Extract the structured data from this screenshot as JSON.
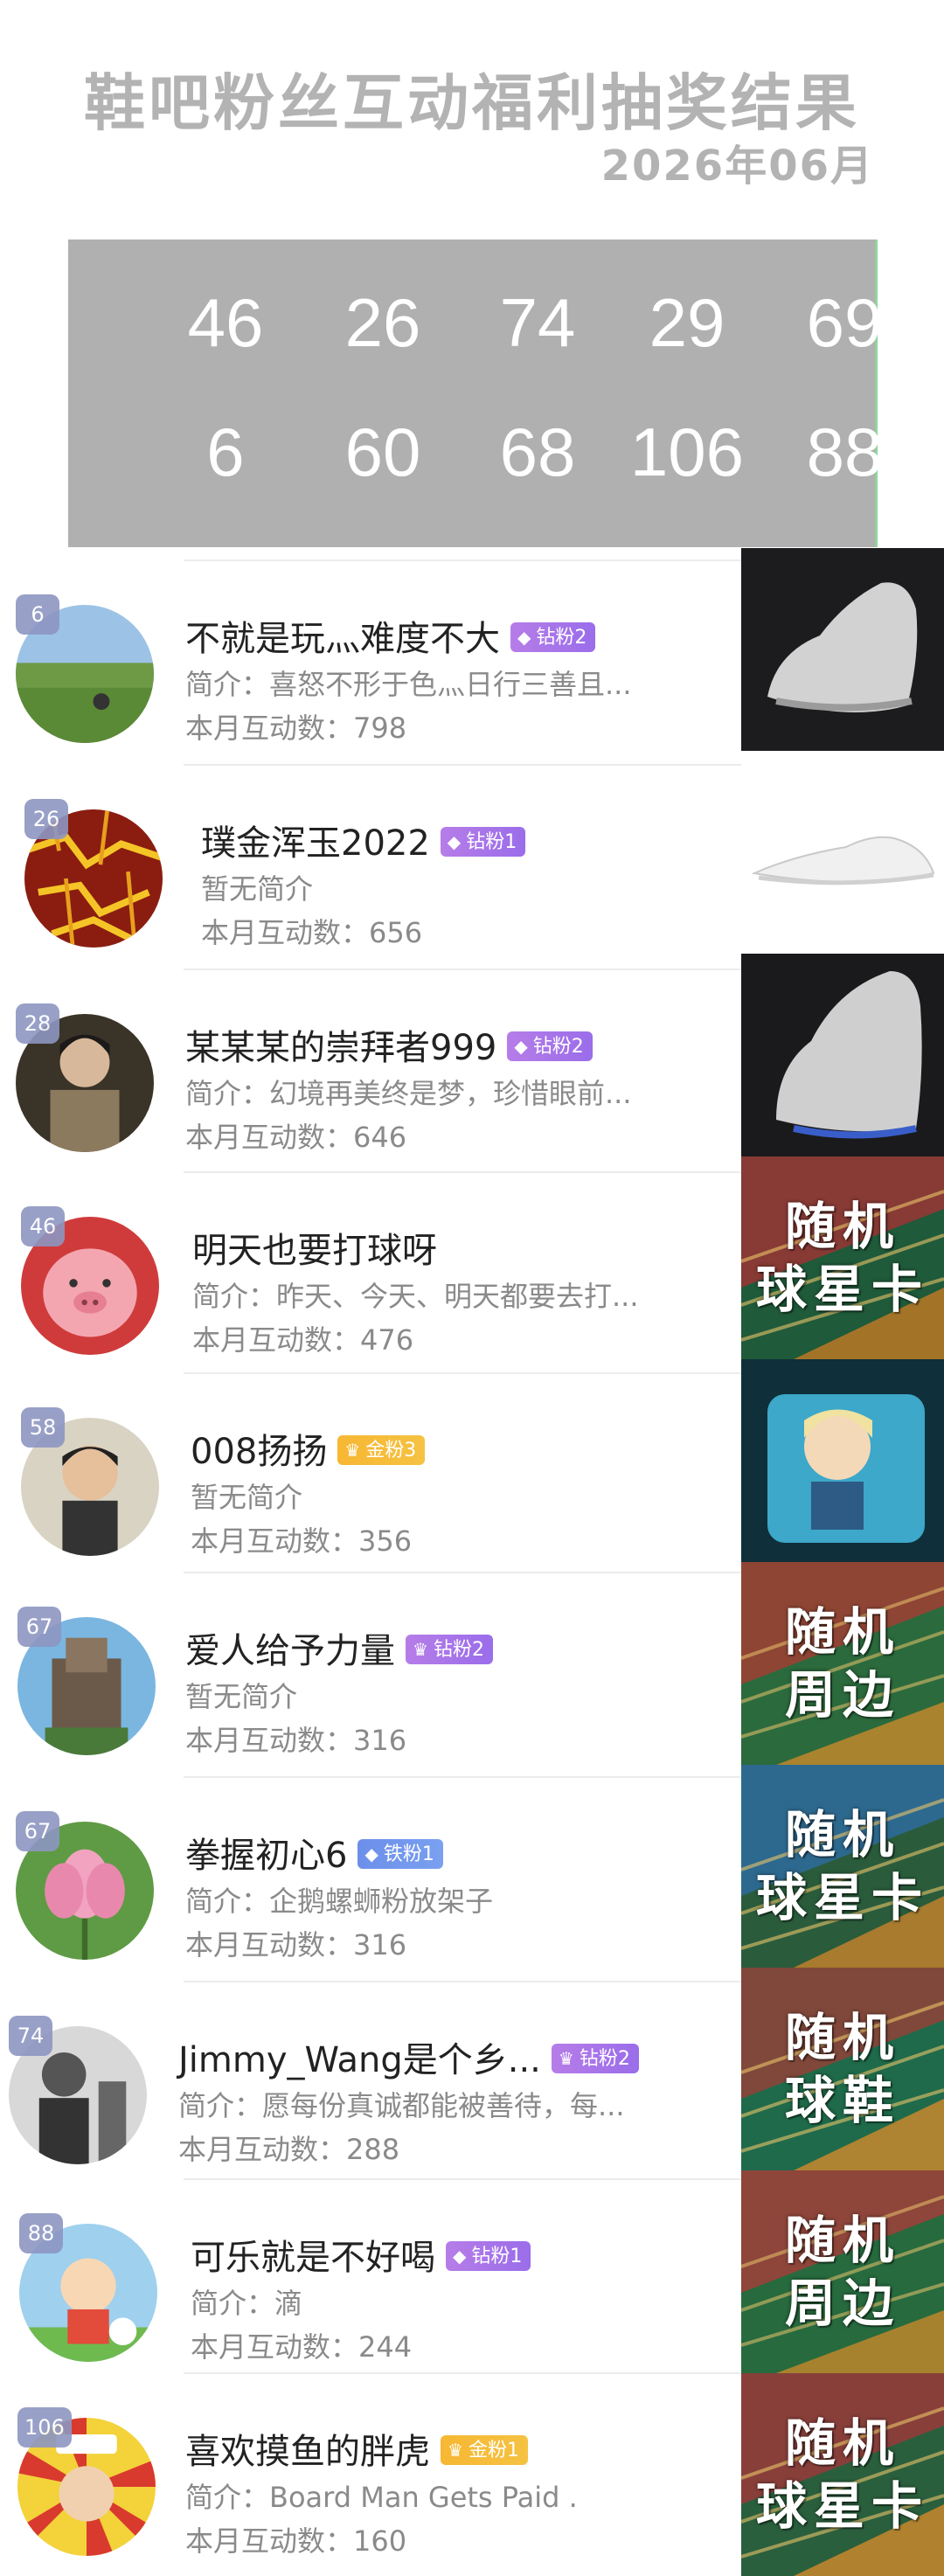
{
  "header": {
    "title": "鞋吧粉丝互动福利抽奖结果",
    "date": "2026年06月"
  },
  "winning_numbers": [
    [
      "46",
      "26",
      "74",
      "29",
      "69"
    ],
    [
      "6",
      "60",
      "68",
      "106",
      "88"
    ]
  ],
  "winners": [
    {
      "rank": "6",
      "name": "不就是玩灬难度不大",
      "badge": "钻粉2",
      "badge_type": "diamond",
      "intro": "简介：喜怒不形于色灬日行三善且...",
      "count": "本月互动数：798",
      "prize": "sneaker-gray"
    },
    {
      "rank": "26",
      "name": "璞金浑玉2022",
      "badge": "钻粉1",
      "badge_type": "diamond",
      "intro": "暂无简介",
      "count": "本月互动数：656",
      "prize": "sneaker-white"
    },
    {
      "rank": "28",
      "name": "某某某的崇拜者999",
      "badge": "钻粉2",
      "badge_type": "diamond",
      "intro": "简介：幻境再美终是梦，珍惜眼前...",
      "count": "本月互动数：646",
      "prize": "sneaker-blue"
    },
    {
      "rank": "46",
      "name": "明天也要打球呀",
      "badge": "",
      "badge_type": "none",
      "intro": "简介：昨天、今天、明天都要去打...",
      "count": "本月互动数：476",
      "prize_text": [
        "随机",
        "球星卡"
      ]
    },
    {
      "rank": "58",
      "name": "008扬扬",
      "badge": "金粉3",
      "badge_type": "gold",
      "intro": "暂无简介",
      "count": "本月互动数：356",
      "prize": "anime-pillow"
    },
    {
      "rank": "67",
      "name": "爱人给予力量",
      "badge": "钻粉2",
      "badge_type": "diamond",
      "intro": "暂无简介",
      "count": "本月互动数：316",
      "prize_text": [
        "随机",
        "周边"
      ]
    },
    {
      "rank": "67",
      "name": "拳握初心6",
      "badge": "铁粉1",
      "badge_type": "iron",
      "intro": "简介：企鹅螺蛳粉放架子",
      "count": "本月互动数：316",
      "prize_text": [
        "随机",
        "球星卡"
      ]
    },
    {
      "rank": "74",
      "name": "Jimmy_Wang是个乡...",
      "badge": "钻粉2",
      "badge_type": "diamond",
      "intro": "简介：愿每份真诚都能被善待，每...",
      "count": "本月互动数：288",
      "prize_text": [
        "随机",
        "球鞋"
      ]
    },
    {
      "rank": "88",
      "name": "可乐就是不好喝",
      "badge": "钻粉1",
      "badge_type": "diamond",
      "intro": "简介：滴",
      "count": "本月互动数：244",
      "prize_text": [
        "随机",
        "周边"
      ]
    },
    {
      "rank": "106",
      "name": "喜欢摸鱼的胖虎",
      "badge": "金粉1",
      "badge_type": "gold",
      "intro": "简介：Board Man Gets Paid .",
      "count": "本月互动数：160",
      "prize_text": [
        "随机",
        "球星卡"
      ]
    }
  ],
  "colors": {
    "title": "#b3b3b3",
    "number_box": "#b0b0b0",
    "diamond_badge": "#a874ea",
    "gold_badge": "#f5b935",
    "iron_badge": "#6c8fea"
  }
}
